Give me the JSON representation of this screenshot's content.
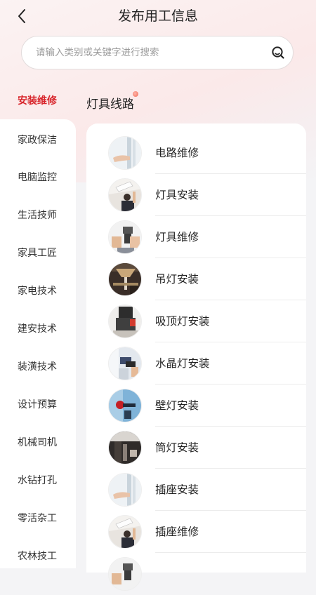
{
  "header": {
    "title": "发布用工信息"
  },
  "search": {
    "placeholder": "请输入类别或关键字进行搜索"
  },
  "sidebar": {
    "active": "安装维修",
    "items": [
      "家政保洁",
      "电脑监控",
      "生活技师",
      "家具工匠",
      "家电技术",
      "建安技术",
      "装潢技术",
      "设计预算",
      "机械司机",
      "水钻打孔",
      "零活杂工",
      "农林技工"
    ]
  },
  "section": {
    "title": "灯具线路"
  },
  "list": [
    {
      "label": "电路维修",
      "icon": "curtain-hand-photo"
    },
    {
      "label": "灯具安装",
      "icon": "lamp-install-photo"
    },
    {
      "label": "灯具维修",
      "icon": "lamp-repair-photo"
    },
    {
      "label": "吊灯安装",
      "icon": "chandelier-photo"
    },
    {
      "label": "吸顶灯安装",
      "icon": "ceiling-light-photo"
    },
    {
      "label": "水晶灯安装",
      "icon": "crystal-light-photo"
    },
    {
      "label": "壁灯安装",
      "icon": "wall-light-photo"
    },
    {
      "label": "筒灯安装",
      "icon": "downlight-photo"
    },
    {
      "label": "插座安装",
      "icon": "curtain-hand-photo"
    },
    {
      "label": "插座维修",
      "icon": "lamp-install-photo"
    }
  ],
  "colors": {
    "accent": "#d8262c",
    "background": "#f4f4f6"
  }
}
